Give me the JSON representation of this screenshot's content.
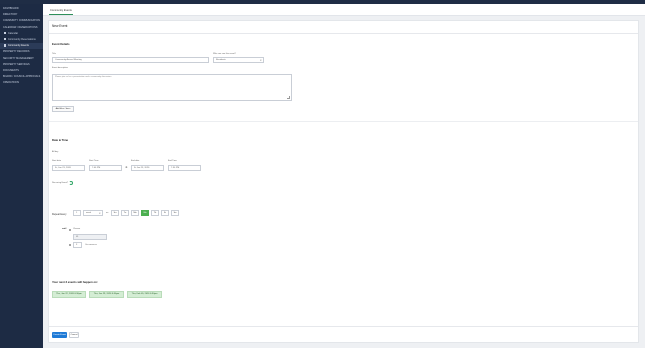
{
  "sidebar": {
    "items": [
      {
        "label": "DASHBOARD"
      },
      {
        "label": "DIRECTORY"
      },
      {
        "label": "COMMUNITY COMMUNICATION"
      },
      {
        "label": "CALENDAR / RESERVATIONS"
      },
      {
        "label": "Calendar",
        "sub": true
      },
      {
        "label": "Community Reservations",
        "sub": true
      },
      {
        "label": "Community Events",
        "sub": true,
        "active": true
      },
      {
        "label": "PROPERTY RECORDS"
      },
      {
        "label": "SECURITY MANAGEMENT"
      },
      {
        "label": "PROPERTY SERVICES"
      },
      {
        "label": "DOCUMENTS"
      },
      {
        "label": "BOARD / COUNCIL APPROVALS"
      },
      {
        "label": "OPERATIONS"
      }
    ]
  },
  "tab": {
    "label": "Community Events"
  },
  "card": {
    "title": "New Event"
  },
  "event_details": {
    "section_title": "Event Details",
    "title_label": "Title",
    "title_value": "Community Annual Meeting",
    "audience_label": "Who can see this event?",
    "audience_value": "Residents",
    "description_label": "Event description",
    "description_placeholder": "Please join us for a presentation and a community discussion",
    "add_files_label": "Add files / docs"
  },
  "date_time": {
    "section_title": "Date & Time",
    "all_day_label": "All day",
    "start_date_label": "Start date",
    "start_date_value": "Fr, Jan 23, 2026",
    "start_time_label": "Start Time",
    "start_time_value": "7:00 PM",
    "end_date_label": "End date",
    "end_date_value": "Fr Jan 23, 2026",
    "end_time_label": "End Time",
    "end_time_value": "7:30 PM",
    "recurring_label": "Recurring Event?"
  },
  "repeat": {
    "label": "Repeat Every",
    "count": "1",
    "unit": "week",
    "on_label": "on",
    "days": [
      {
        "label": "Su",
        "selected": false
      },
      {
        "label": "Tu",
        "selected": false
      },
      {
        "label": "Mo",
        "selected": false
      },
      {
        "label": "We",
        "selected": true
      },
      {
        "label": "Th",
        "selected": false
      },
      {
        "label": "Fr",
        "selected": false
      },
      {
        "label": "Sa",
        "selected": false
      }
    ],
    "until_label": "until",
    "option_on_date_label": "Choose",
    "option_after_label": "Occurrences",
    "occurrences_value": "3",
    "until_date_value": "01"
  },
  "next_events": {
    "title": "Your next 3 events will happen on:",
    "items": [
      "Thu, Jan 22, 2026 6:30pm",
      "Thu, Jan 29, 2026 6:30pm",
      "Thu, Feb 05, 2026 6:30pm"
    ]
  },
  "actions": {
    "create_label": "Create Event",
    "cancel_label": "Cancel"
  },
  "colors": {
    "sidebar_bg": "#1d2b44",
    "accent_green": "#4caf50",
    "primary_blue": "#1f7ad6",
    "chip_bg": "#d4edd4"
  }
}
